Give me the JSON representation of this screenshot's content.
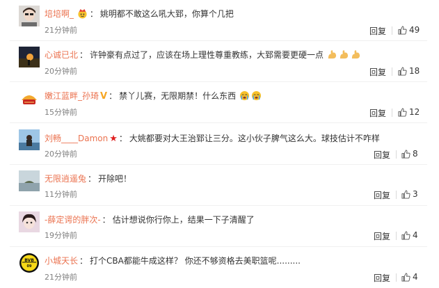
{
  "comments": [
    {
      "user": "培培啊_",
      "badge": "emoji",
      "text": "姚明都不敢这么吼大郅，你算个几把",
      "time": "21分钟前",
      "reply": "回复",
      "likes": "49"
    },
    {
      "user": "心诚已北",
      "badge": "",
      "text": "许钟豪有点过了，应该在场上理性尊重教练，大郅需要更硬一点",
      "time": "20分钟前",
      "reply": "回复",
      "likes": "18"
    },
    {
      "user": "嫩江蓝畔_孙琦",
      "badge": "V",
      "text": "禁丫儿赛，无限期禁！什么东西",
      "time": "15分钟前",
      "reply": "回复",
      "likes": "12"
    },
    {
      "user": "刘畅____Damon",
      "badge": "star",
      "text": "大姚都要对大王治郅让三分。这小伙子脾气这么大。球技估计不咋样",
      "time": "20分钟前",
      "reply": "回复",
      "likes": "8"
    },
    {
      "user": "无限逍遥兔",
      "badge": "",
      "text": "开除吧！",
      "time": "11分钟前",
      "reply": "回复",
      "likes": "3"
    },
    {
      "user": "-薛定谔的胖次-",
      "badge": "",
      "text": "估计想说你行你上，结果一下子清醒了",
      "time": "19分钟前",
      "reply": "回复",
      "likes": "4"
    },
    {
      "user": "小城天长",
      "badge": "",
      "text": "打个CBA都能牛成这样？ 你还不够资格去美职篮呢.........",
      "time": "21分钟前",
      "reply": "回复",
      "likes": "4"
    }
  ],
  "icons": {
    "like": "thumbs-up-icon",
    "flex": "flexed-arm-emoji",
    "cry": "crying-face-emoji"
  },
  "colors": {
    "username": "#eb7350",
    "text": "#333333",
    "time": "#808080"
  }
}
